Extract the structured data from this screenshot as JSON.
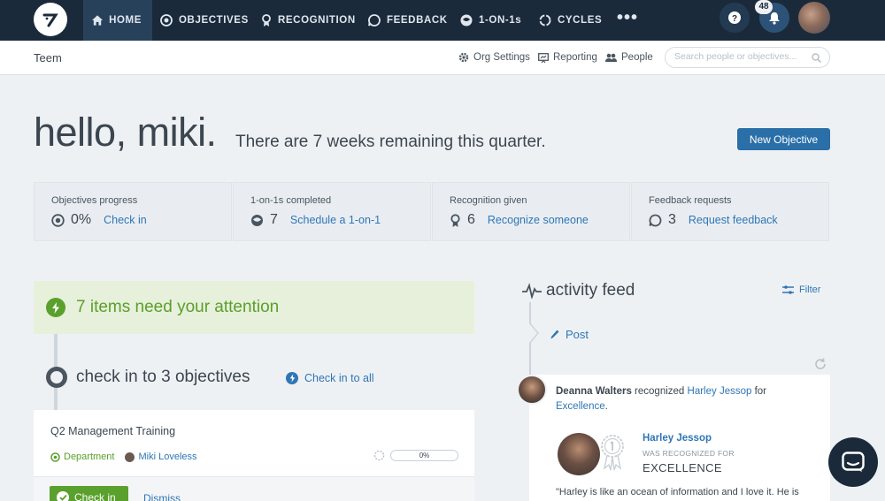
{
  "nav": {
    "items": [
      {
        "label": "HOME",
        "icon": "home-icon"
      },
      {
        "label": "OBJECTIVES",
        "icon": "target-icon"
      },
      {
        "label": "RECOGNITION",
        "icon": "award-icon"
      },
      {
        "label": "FEEDBACK",
        "icon": "feedback-icon"
      },
      {
        "label": "1-ON-1s",
        "icon": "one-on-one-icon"
      },
      {
        "label": "CYCLES",
        "icon": "cycles-icon"
      }
    ],
    "more": "•••",
    "notification_count": "48"
  },
  "subheader": {
    "org_name": "Teem",
    "org_settings": "Org Settings",
    "reporting": "Reporting",
    "people": "People",
    "search_placeholder": "Search people or objectives..."
  },
  "hero": {
    "greeting": "hello, miki.",
    "weeks_remaining": "There are 7 weeks remaining this quarter.",
    "new_objective": "New Objective"
  },
  "stats": [
    {
      "label": "Objectives progress",
      "value": "0%",
      "link": "Check in"
    },
    {
      "label": "1-on-1s completed",
      "value": "7",
      "link": "Schedule a 1-on-1"
    },
    {
      "label": "Recognition given",
      "value": "6",
      "link": "Recognize someone"
    },
    {
      "label": "Feedback requests",
      "value": "3",
      "link": "Request feedback"
    }
  ],
  "attention": {
    "title": "7 items need your attention",
    "checkin_heading": "check in to 3 objectives",
    "checkin_all": "Check in to all"
  },
  "objective": {
    "title": "Q2 Management Training",
    "department": "Department",
    "owner": "Miki Loveless",
    "progress": "0%",
    "checkin": "Check in",
    "dismiss": "Dismiss"
  },
  "feed": {
    "title": "activity feed",
    "filter": "Filter",
    "post": "Post",
    "item": {
      "actor": "Deanna Walters",
      "verb": " recognized ",
      "target": "Harley Jessop",
      "prep": " for",
      "value_link": "Excellence",
      "period": ".",
      "recipient": "Harley Jessop",
      "recognized_for": "WAS RECOGNIZED FOR",
      "value": "EXCELLENCE",
      "quote": "\"Harley is like an ocean of information and I love it. He is"
    }
  },
  "colors": {
    "nav_bg": "#1b2a3a",
    "accent_blue": "#2a6fa8",
    "link_blue": "#2f76b5",
    "green": "#5aa02c"
  }
}
